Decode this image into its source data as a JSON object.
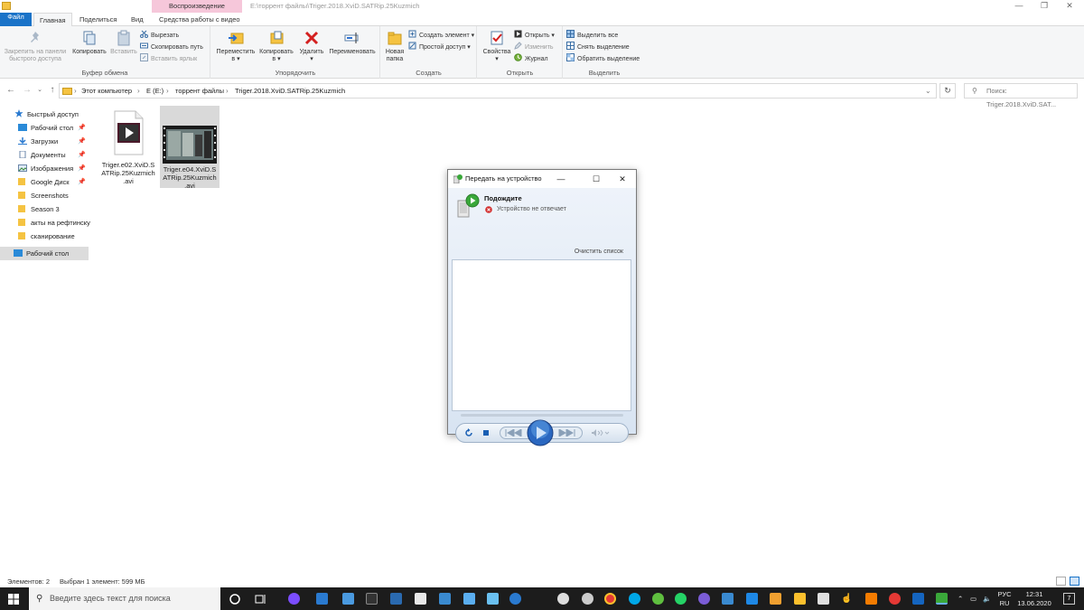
{
  "titlebar": {
    "context_tab": "Воспроизведение",
    "path": "E:\\торрент файлы\\Triger.2018.XviD.SATRip.25Kuzmich"
  },
  "tabs": [
    "Файл",
    "Главная",
    "Поделиться",
    "Вид",
    "Средства работы с видео"
  ],
  "ribbon": {
    "clipboard": {
      "label": "Буфер обмена",
      "pin": "Закрепить на панели быстрого доступа",
      "pin_line1": "Закрепить на панели",
      "pin_line2": "быстрого доступа",
      "copy": "Копировать",
      "paste": "Вставить",
      "cut": "Вырезать",
      "copy_path": "Скопировать путь",
      "paste_shortcut": "Вставить ярлык"
    },
    "organize": {
      "label": "Упорядочить",
      "move_line1": "Переместить",
      "move_line2": "в ▾",
      "copy_line1": "Копировать",
      "copy_line2": "в ▾",
      "delete_line1": "Удалить",
      "delete_line2": "▾",
      "rename": "Переименовать"
    },
    "new": {
      "label": "Создать",
      "folder_line1": "Новая",
      "folder_line2": "папка",
      "new_item": "Создать элемент ▾",
      "easy_access": "Простой доступ ▾"
    },
    "open": {
      "label": "Открыть",
      "properties_line1": "Свойства",
      "properties_line2": "▾",
      "open": "Открыть ▾",
      "edit": "Изменить",
      "history": "Журнал"
    },
    "select": {
      "label": "Выделить",
      "select_all": "Выделить все",
      "select_none": "Снять выделение",
      "invert": "Обратить выделение"
    }
  },
  "address": {
    "crumbs": [
      "Этот компьютер",
      "E (E:)",
      "торрент файлы",
      "Triger.2018.XviD.SATRip.25Kuzmich"
    ],
    "search_placeholder": "Поиск: Triger.2018.XviD.SAT..."
  },
  "nav": {
    "quick_access": "Быстрый доступ",
    "items": [
      "Рабочий стол",
      "Загрузки",
      "Документы",
      "Изображения",
      "Google Диск",
      "Screenshots",
      "Season 3",
      "акты на рефтинску",
      "сканирование"
    ],
    "desktop": "Рабочий стол"
  },
  "files": [
    {
      "name_line1": "Triger.e02.XviD.S",
      "name_line2": "ATRip.25Kuzmich",
      "name_line3": ".avi"
    },
    {
      "name_line1": "Triger.e04.XviD.S",
      "name_line2": "ATRip.25Kuzmich",
      "name_line3": ".avi"
    }
  ],
  "status": {
    "count": "Элементов: 2",
    "selection": "Выбран 1 элемент: 599 МБ"
  },
  "dialog": {
    "title": "Передать на устройство",
    "status": "Подождите",
    "sub": "Устройство не отвечает",
    "clear": "Очистить список"
  },
  "taskbar": {
    "search_placeholder": "Введите здесь текст для поиска",
    "lang_line1": "РУС",
    "lang_line2": "RU",
    "time": "12:31",
    "date": "13.06.2020",
    "notif_count": "7"
  },
  "colors": {
    "accent": "#1a73c8",
    "context_tab": "#f6c7da",
    "taskbar": "#1c1c1c"
  }
}
